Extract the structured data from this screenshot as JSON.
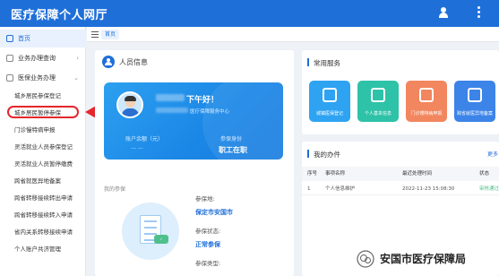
{
  "app_title": "医疗保障个人网厅",
  "sidebar": {
    "home": "首页",
    "business_query": "业务办理查询",
    "insurance_handling": "医保业务办理",
    "items": [
      "城乡居民参保登记",
      "城乡居民暂停参保",
      "门诊慢特病申报",
      "灵活就业人员参保登记",
      "灵活就业人员暂停缴费",
      "跨省就医异地备案",
      "跨省转移接续转出申请",
      "跨省转移接续转入申请",
      "省内关系转移接续申请",
      "个人账户共济管理"
    ]
  },
  "breadcrumb": {
    "home_tab": "首页"
  },
  "person_panel": {
    "title": "人员信息",
    "greeting": "下午好！",
    "agency": "医疗保障服务中心",
    "balance_label": "账户余额（元）",
    "status_label": "参保身份",
    "status_value": "职工在职",
    "my_insurance_label": "我的参保",
    "insured_place_label": "参保地:",
    "insured_place_value": "保定市安国市",
    "insured_state_label": "参保状态:",
    "insured_state_value": "正常参保",
    "insured_type_label": "参保类型:"
  },
  "services": {
    "title": "常用服务",
    "items": [
      {
        "label": "城镇医保登记",
        "color": "#2ea3f2"
      },
      {
        "label": "个人基本信息",
        "color": "#2ec2a8"
      },
      {
        "label": "门诊慢特病申报",
        "color": "#f2865e"
      },
      {
        "label": "跨省就医异地备案",
        "color": "#3c84e8"
      }
    ]
  },
  "tasks": {
    "title": "我的办件",
    "more": "更多",
    "columns": [
      "序号",
      "事项名称",
      "最近处理时间",
      "状态"
    ],
    "rows": [
      [
        "1",
        "个人信息维护",
        "2022-11-23 15:08:30",
        "审核通过"
      ]
    ]
  },
  "watermark": "安国市医疗保障局",
  "colors": {
    "brand": "#1f6fd9",
    "highlight": "#e5262b"
  }
}
